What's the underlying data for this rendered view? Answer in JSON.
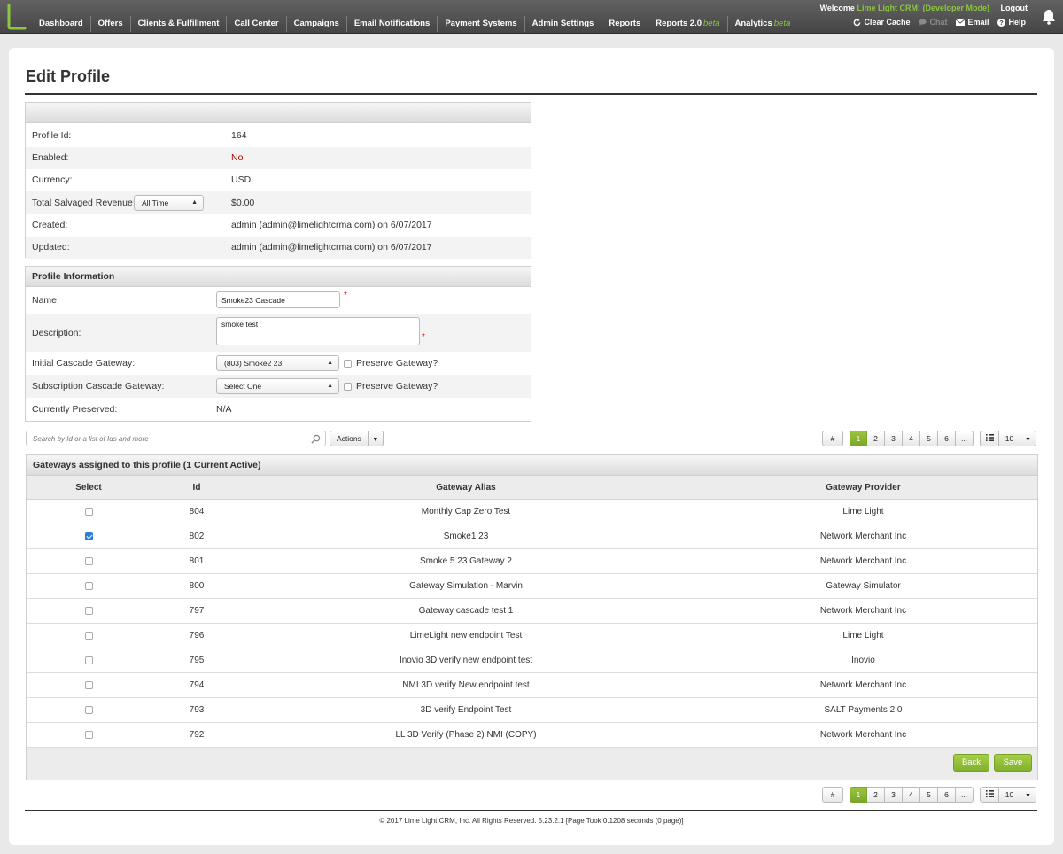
{
  "nav": {
    "items": [
      {
        "label": "Dashboard",
        "beta": ""
      },
      {
        "label": "Offers",
        "beta": ""
      },
      {
        "label": "Clients & Fulfillment",
        "beta": ""
      },
      {
        "label": "Call Center",
        "beta": ""
      },
      {
        "label": "Campaigns",
        "beta": ""
      },
      {
        "label": "Email Notifications",
        "beta": ""
      },
      {
        "label": "Payment Systems",
        "beta": ""
      },
      {
        "label": "Admin Settings",
        "beta": ""
      },
      {
        "label": "Reports",
        "beta": ""
      },
      {
        "label": "Reports 2.0",
        "beta": "beta"
      },
      {
        "label": "Analytics",
        "beta": "beta"
      }
    ],
    "welcome": "Welcome",
    "user": "Lime Light CRM! (Developer Mode)",
    "logout": "Logout",
    "tools": {
      "clear_cache": "Clear Cache",
      "chat": "Chat",
      "email": "Email",
      "help": "Help"
    },
    "accent": "#8cc63f"
  },
  "page": {
    "title": "Edit Profile"
  },
  "summary": {
    "profile_id_label": "Profile Id:",
    "profile_id": "164",
    "enabled_label": "Enabled:",
    "enabled": "No",
    "currency_label": "Currency:",
    "currency": "USD",
    "revenue_label": "Total Salvaged Revenue:",
    "revenue_range": "All Time",
    "revenue": "$0.00",
    "created_label": "Created:",
    "created": "admin (admin@limelightcrma.com) on 6/07/2017",
    "updated_label": "Updated:",
    "updated": "admin (admin@limelightcrma.com) on 6/07/2017"
  },
  "profile_info": {
    "header": "Profile Information",
    "name_label": "Name:",
    "name_value": "Smoke23 Cascade",
    "desc_label": "Description:",
    "desc_value": "smoke test",
    "initial_label": "Initial Cascade Gateway:",
    "initial_value": "(803) Smoke2 23",
    "sub_label": "Subscription Cascade Gateway:",
    "sub_value": "Select One",
    "preserve_label": "Preserve Gateway?",
    "preserved_label": "Currently Preserved:",
    "preserved_value": "N/A",
    "required_mark": "*"
  },
  "search": {
    "placeholder": "Search by Id or a list of Ids and more"
  },
  "actions_label": "Actions",
  "pager": {
    "hash": "#",
    "pages": [
      "1",
      "2",
      "3",
      "4",
      "5",
      "6",
      "..."
    ],
    "per_page": "10"
  },
  "gateways": {
    "header": "Gateways assigned to this profile (1 Current Active)",
    "columns": {
      "select": "Select",
      "id": "Id",
      "alias": "Gateway Alias",
      "provider": "Gateway Provider"
    },
    "rows": [
      {
        "id": "804",
        "alias": "Monthly Cap Zero Test",
        "provider": "Lime Light",
        "checked": false
      },
      {
        "id": "802",
        "alias": "Smoke1 23",
        "provider": "Network Merchant Inc",
        "checked": true
      },
      {
        "id": "801",
        "alias": "Smoke 5.23 Gateway 2",
        "provider": "Network Merchant Inc",
        "checked": false
      },
      {
        "id": "800",
        "alias": "Gateway Simulation - Marvin",
        "provider": "Gateway Simulator",
        "checked": false
      },
      {
        "id": "797",
        "alias": "Gateway cascade test 1",
        "provider": "Network Merchant Inc",
        "checked": false
      },
      {
        "id": "796",
        "alias": "LimeLight new endpoint Test",
        "provider": "Lime Light",
        "checked": false
      },
      {
        "id": "795",
        "alias": "Inovio 3D verify new endpoint test",
        "provider": "Inovio",
        "checked": false
      },
      {
        "id": "794",
        "alias": "NMI 3D verify New endpoint test",
        "provider": "Network Merchant Inc",
        "checked": false
      },
      {
        "id": "793",
        "alias": "3D verify Endpoint Test",
        "provider": "SALT Payments 2.0",
        "checked": false
      },
      {
        "id": "792",
        "alias": "LL 3D Verify (Phase 2) NMI (COPY)",
        "provider": "Network Merchant Inc",
        "checked": false
      }
    ],
    "back_label": "Back",
    "save_label": "Save"
  },
  "footer": {
    "text": "© 2017 Lime Light CRM, Inc. All Rights Reserved. 5.23.2.1 [Page Took 0.1208 seconds (0 page)]"
  }
}
